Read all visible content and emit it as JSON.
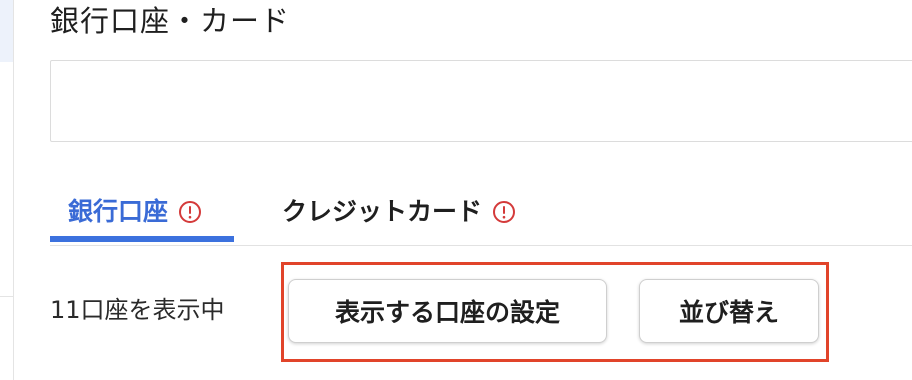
{
  "section": {
    "title": "銀行口座・カード"
  },
  "tabs": [
    {
      "label": "銀行口座",
      "active": true,
      "icon": "alert-circle-icon"
    },
    {
      "label": "クレジットカード",
      "active": false,
      "icon": "alert-circle-icon"
    }
  ],
  "accounts": {
    "count_text": "11口座を表示中"
  },
  "actions": {
    "display_settings_label": "表示する口座の設定",
    "sort_label": "並び替え"
  },
  "colors": {
    "active_tab": "#3a6bd6",
    "active_underline": "#3c71de",
    "alert_icon": "#d43a3a",
    "highlight_frame": "#e1442a"
  }
}
